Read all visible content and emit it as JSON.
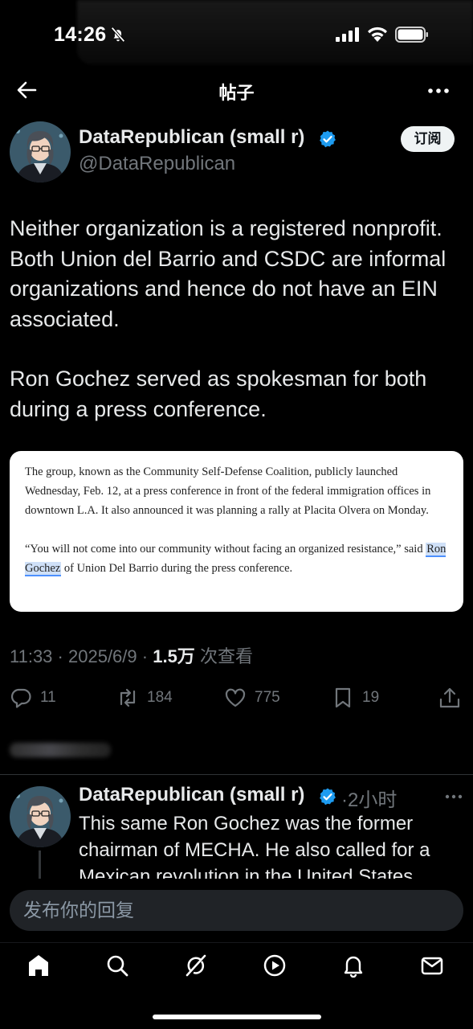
{
  "status_bar": {
    "time": "14:26",
    "icons": [
      "bell-off-icon",
      "cellular-signal-icon",
      "wifi-icon",
      "battery-icon"
    ]
  },
  "topbar": {
    "title": "帖子",
    "back_icon": "back-arrow-icon",
    "more_icon": "more-icon"
  },
  "post": {
    "author_name": "DataRepublican (small r)",
    "handle": "@DataRepublican",
    "verified": true,
    "subscribe_label": "订阅",
    "paragraph1": "Neither organization is a registered nonprofit. Both Union del Barrio and CSDC are informal organizations and hence do not have an EIN associated.",
    "paragraph2": "Ron Gochez served as spokesman for both during a press conference.",
    "quote_image": {
      "paragraph1": "The group, known as the Community Self-Defense Coalition, publicly launched Wednesday, Feb. 12, at a press conference in front of the federal immigration offices in downtown L.A. It also announced it was planning a rally at Placita Olvera on Monday.",
      "paragraph2_before": "“You will not come into our community without facing an organized resistance,” said ",
      "paragraph2_highlight": "Ron Gochez",
      "paragraph2_after": " of Union Del Barrio during the press conference."
    },
    "meta": {
      "time": "11:33",
      "date": "2025/6/9",
      "views": "1.5万",
      "views_label": "次查看"
    },
    "actions": {
      "replies": "11",
      "reposts": "184",
      "likes": "775",
      "bookmarks": "19"
    }
  },
  "reply": {
    "author_name": "DataRepublican (small r)",
    "verified": true,
    "time": "2小时",
    "text": "This same Ron Gochez was the former chairman of MECHA. He also called for a Mexican revolution in the United States."
  },
  "compose": {
    "placeholder": "发布你的回复"
  },
  "bottom_nav": {
    "items": [
      "home-icon",
      "search-icon",
      "grok-icon",
      "video-icon",
      "notifications-icon",
      "messages-icon"
    ]
  },
  "colors": {
    "background": "#000000",
    "text_primary": "#e7e9ea",
    "text_secondary": "#71767b",
    "verified_blue": "#1d9bf0"
  }
}
